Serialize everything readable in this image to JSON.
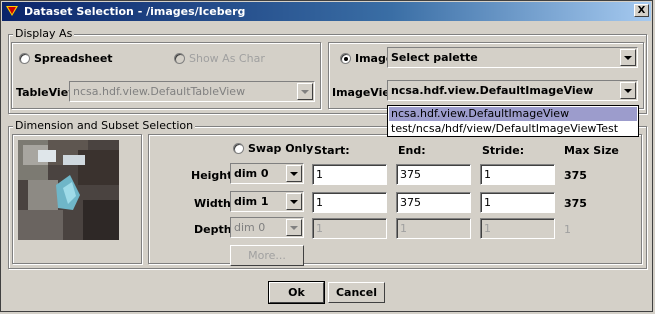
{
  "window": {
    "title": "Dataset Selection - /images/Iceberg",
    "close_label": "X"
  },
  "display_as": {
    "group_label": "Display As",
    "spreadsheet_label": "Spreadsheet",
    "show_as_char_label": "Show As Char",
    "tableview_label": "TableView:",
    "tableview_value": "ncsa.hdf.view.DefaultTableView",
    "image_label": "Image",
    "palette_value": "Select palette",
    "imageview_label": "ImageView:",
    "imageview_value": "ncsa.hdf.view.DefaultImageView",
    "imageview_options": [
      "ncsa.hdf.view.DefaultImageView",
      "test/ncsa/hdf/view/DefaultImageViewTest"
    ],
    "selected_option_index": 0
  },
  "subset": {
    "group_label": "Dimension and Subset Selection",
    "swap_only_label": "Swap Only",
    "headers": {
      "start": "Start:",
      "end": "End:",
      "stride": "Stride:",
      "max": "Max Size"
    },
    "rows": [
      {
        "label": "Height",
        "dim": "dim 0",
        "start": "1",
        "end": "375",
        "stride": "1",
        "max": "375",
        "enabled": true
      },
      {
        "label": "Width",
        "dim": "dim 1",
        "start": "1",
        "end": "375",
        "stride": "1",
        "max": "375",
        "enabled": true
      },
      {
        "label": "Depth",
        "dim": "dim 0",
        "start": "1",
        "end": "1",
        "stride": "1",
        "max": "1",
        "enabled": false
      }
    ],
    "more_label": "More..."
  },
  "buttons": {
    "ok": "Ok",
    "cancel": "Cancel"
  },
  "colors": {
    "title_bar_start": "#0a246a",
    "title_bar_end": "#a6caf0",
    "selection": "#9c9ccc",
    "background": "#d4d0c8"
  }
}
